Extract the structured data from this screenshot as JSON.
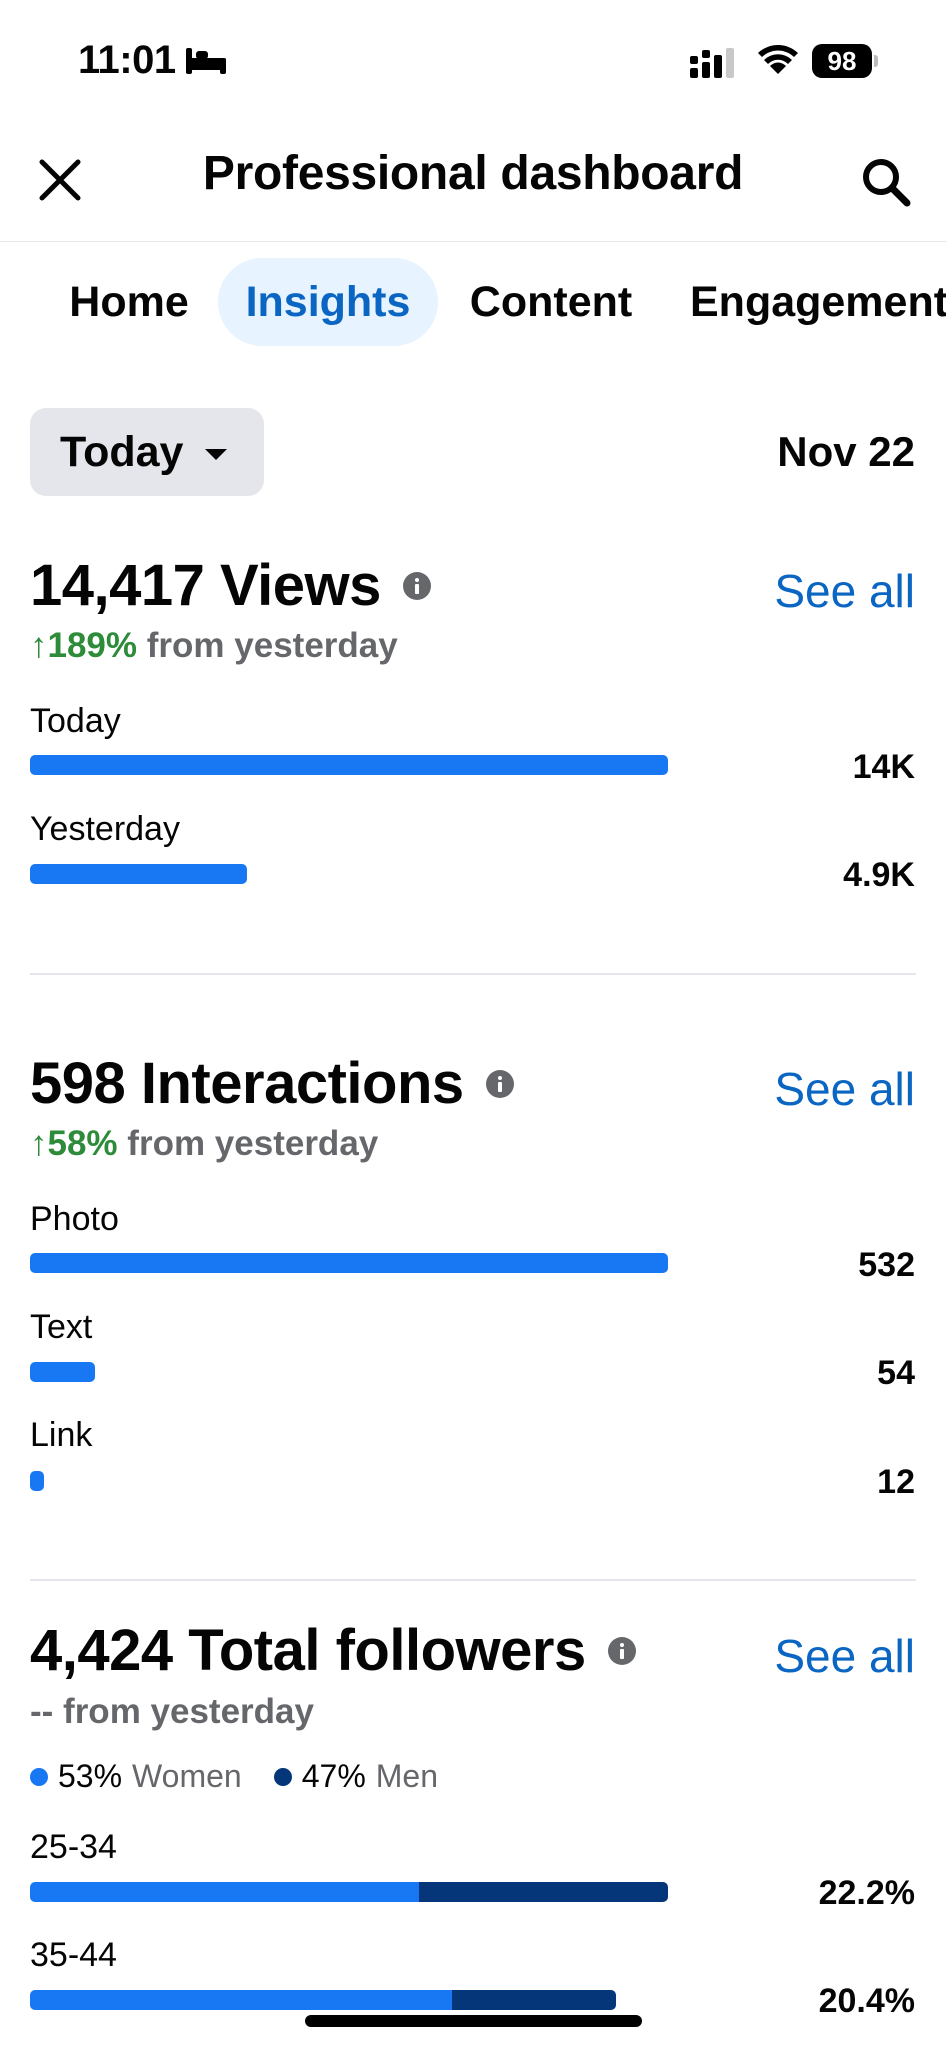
{
  "status_bar": {
    "time": "11:01",
    "battery": "98"
  },
  "header": {
    "title": "Professional dashboard"
  },
  "tabs": [
    {
      "label": "Home",
      "active": false
    },
    {
      "label": "Insights",
      "active": true
    },
    {
      "label": "Content",
      "active": false
    },
    {
      "label": "Engagement",
      "active": false
    }
  ],
  "range": {
    "selected": "Today",
    "date": "Nov 22"
  },
  "views": {
    "title": "14,417 Views",
    "see_all": "See all",
    "change": "↑189%",
    "change_suffix": "from yesterday",
    "bars": [
      {
        "label": "Today",
        "value_text": "14K",
        "value": 14417
      },
      {
        "label": "Yesterday",
        "value_text": "4.9K",
        "value": 4900
      }
    ]
  },
  "interactions": {
    "title": "598 Interactions",
    "see_all": "See all",
    "change": "↑58%",
    "change_suffix": "from yesterday",
    "bars": [
      {
        "label": "Photo",
        "value_text": "532",
        "value": 532
      },
      {
        "label": "Text",
        "value_text": "54",
        "value": 54
      },
      {
        "label": "Link",
        "value_text": "12",
        "value": 12
      }
    ]
  },
  "followers": {
    "title": "4,424 Total followers",
    "see_all": "See all",
    "change_text": "-- from yesterday",
    "legend": {
      "women_pct": "53%",
      "women_label": "Women",
      "men_pct": "47%",
      "men_label": "Men"
    },
    "age_groups": [
      {
        "label": "25-34",
        "value_text": "22.2%",
        "value": 22.2,
        "women_share": 0.61
      },
      {
        "label": "35-44",
        "value_text": "20.4%",
        "value": 20.4,
        "women_share": 0.72
      }
    ]
  },
  "colors": {
    "accent": "#0a66c2",
    "bar_primary": "#1877f2",
    "bar_men": "#06367a",
    "positive": "#2e8b3a",
    "secondary_text": "#65676b"
  }
}
